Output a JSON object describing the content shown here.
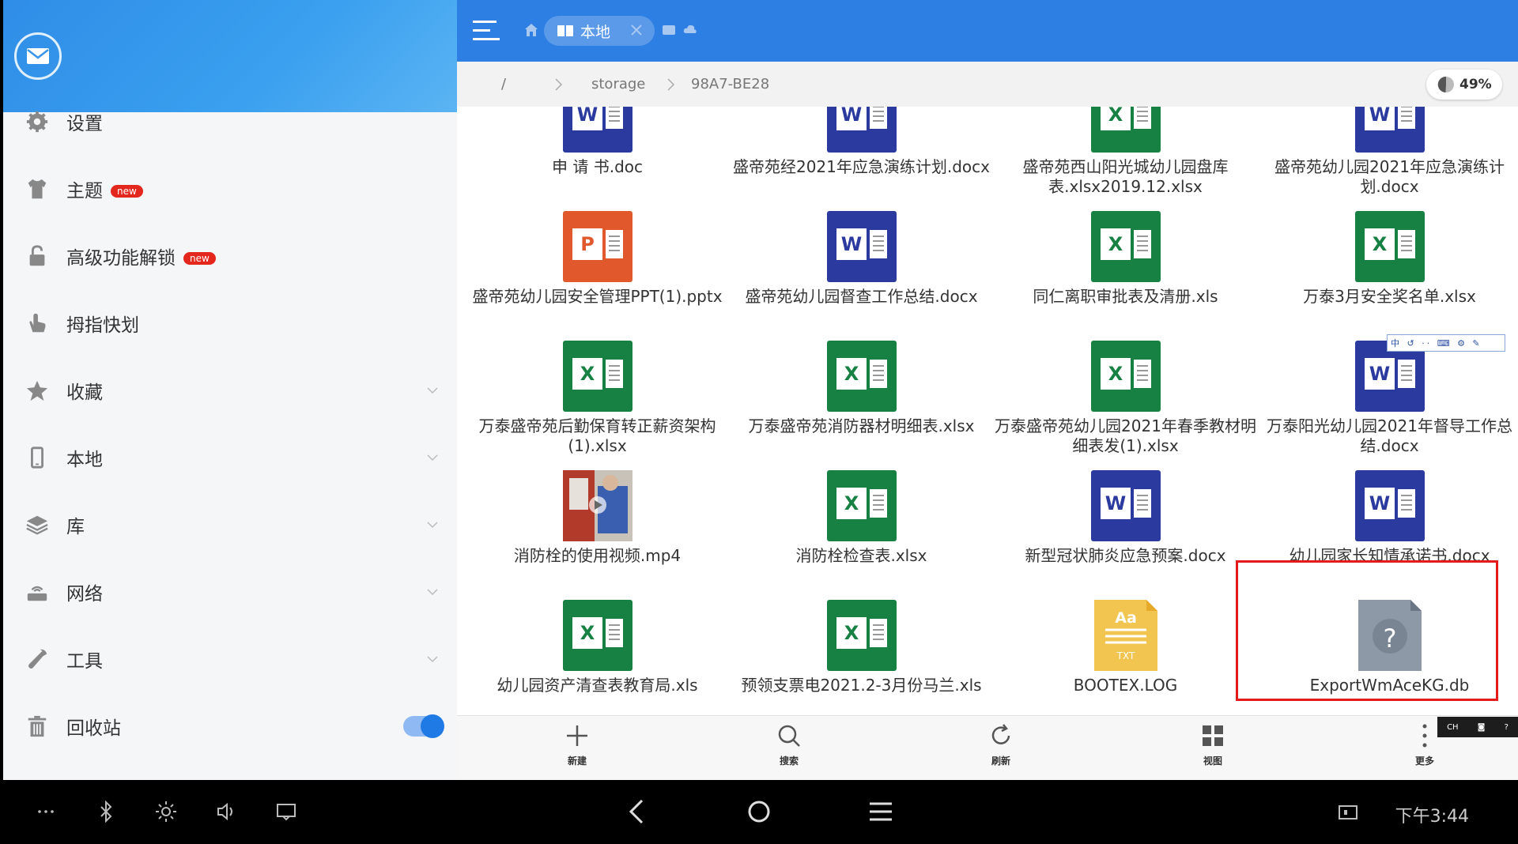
{
  "sidebar": {
    "items": [
      {
        "label": "设置",
        "icon": "gear-icon"
      },
      {
        "label": "主题",
        "icon": "shirt-icon",
        "badge": "new"
      },
      {
        "label": "高级功能解锁",
        "icon": "lock-icon",
        "badge": "new"
      },
      {
        "label": "拇指快划",
        "icon": "thumb-icon"
      },
      {
        "label": "收藏",
        "icon": "star-icon"
      },
      {
        "label": "本地",
        "icon": "phone-icon"
      },
      {
        "label": "库",
        "icon": "layers-icon"
      },
      {
        "label": "网络",
        "icon": "router-icon"
      },
      {
        "label": "工具",
        "icon": "wrench-icon"
      },
      {
        "label": "回收站",
        "icon": "trash-icon"
      }
    ],
    "recycle_toggle_on": true
  },
  "topbar": {
    "tab_label": "本地"
  },
  "path": {
    "root": "/",
    "segments": [
      "storage",
      "98A7-BE28"
    ],
    "usage": "49%"
  },
  "files": [
    {
      "name": "申 请 书.doc",
      "type": "word"
    },
    {
      "name": "盛帝苑经2021年应急演练计划.docx",
      "type": "word"
    },
    {
      "name": "盛帝苑西山阳光城幼儿园盘库表.xlsx2019.12.xlsx",
      "type": "excel"
    },
    {
      "name": "盛帝苑幼儿园2021年应急演练计划.docx",
      "type": "word"
    },
    {
      "name": "盛帝苑幼儿园安全管理PPT(1).pptx",
      "type": "ppt"
    },
    {
      "name": "盛帝苑幼儿园督查工作总结.docx",
      "type": "word"
    },
    {
      "name": "同仁离职审批表及清册.xls",
      "type": "excel"
    },
    {
      "name": "万泰3月安全奖名单.xlsx",
      "type": "excel"
    },
    {
      "name": "万泰盛帝苑后勤保育转正薪资架构(1).xlsx",
      "type": "excel"
    },
    {
      "name": "万泰盛帝苑消防器材明细表.xlsx",
      "type": "excel"
    },
    {
      "name": "万泰盛帝苑幼儿园2021年春季教材明细表发(1).xlsx",
      "type": "excel"
    },
    {
      "name": "万泰阳光幼儿园2021年督导工作总结.docx",
      "type": "word"
    },
    {
      "name": "消防栓的使用视频.mp4",
      "type": "video"
    },
    {
      "name": "消防栓检查表.xlsx",
      "type": "excel"
    },
    {
      "name": "新型冠状肺炎应急预案.docx",
      "type": "word"
    },
    {
      "name": "幼儿园家长知情承诺书.docx",
      "type": "word"
    },
    {
      "name": "幼儿园资产清查表教育局.xls",
      "type": "excel"
    },
    {
      "name": "预领支票电2021.2-3月份马兰.xls",
      "type": "excel"
    },
    {
      "name": "BOOTEX.LOG",
      "type": "txt"
    },
    {
      "name": "ExportWmAceKG.db",
      "type": "unknown",
      "selected": true
    }
  ],
  "toolbar": {
    "new": "新建",
    "search": "搜索",
    "refresh": "刷新",
    "view": "视图",
    "more": "更多"
  },
  "status": {
    "time": "下午3:44"
  },
  "icons": {
    "txt_label": "TXT",
    "txt_glyph": "Aa",
    "unknown_glyph": "?",
    "ime_top": "中 ↺ ·· ⌨ ⚙ ✎",
    "ime_bottom": "CH"
  },
  "colors": {
    "accent": "#2e7fe3",
    "word": "#2b3a9f",
    "excel": "#178043",
    "ppt": "#e0582b",
    "selection": "#e31b1b"
  }
}
